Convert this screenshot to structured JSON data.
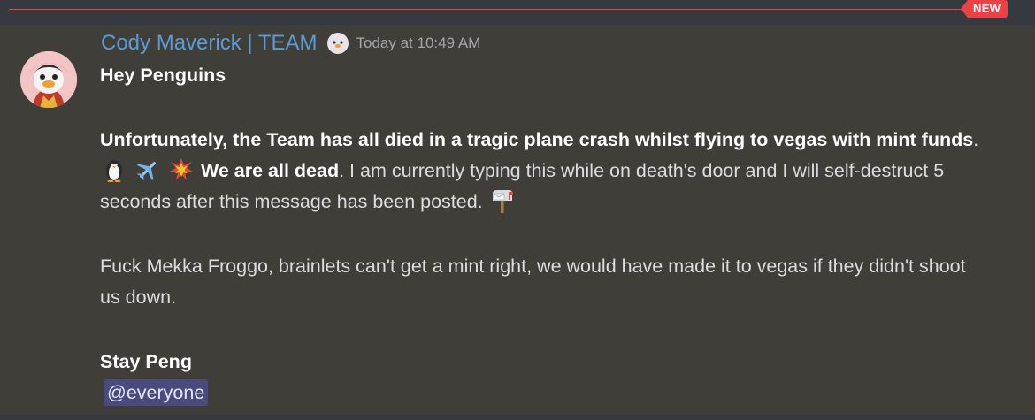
{
  "divider": {
    "badge": "NEW",
    "color": "#ed4245"
  },
  "message": {
    "author": "Cody Maverick | TEAM",
    "author_color": "#5b9bd5",
    "role_icon": "penguin-face-icon",
    "timestamp": "Today at 10:49 AM",
    "greeting": "Hey Penguins",
    "p1_bold": "Unfortunately, the Team has all died in a tragic plane crash whilst flying to vegas with mint funds",
    "p1_period": ".",
    "p1_emojis": [
      "penguin-emoji",
      "airplane-emoji",
      "collision-emoji"
    ],
    "p1_bold2": "We are all dead",
    "p1_rest": ". I am currently typing this while on death's door and I will self-destruct 5 seconds after this message has been posted.",
    "p1_end_emoji": "mailbox-emoji",
    "p2": "Fuck Mekka Froggo, brainlets can't get a mint right, we would have made it to vegas if they didn't shoot us down.",
    "signoff": "Stay Peng",
    "mention": "@everyone",
    "mention_color": "#4a4b7c"
  }
}
